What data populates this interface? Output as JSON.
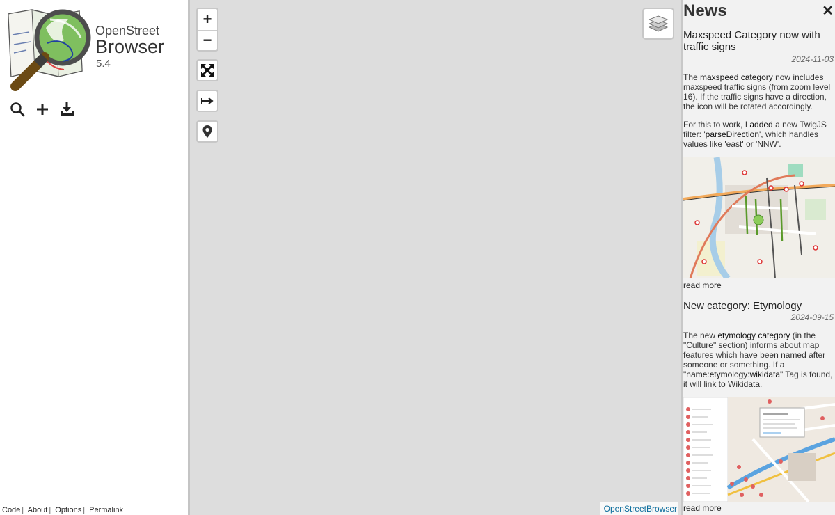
{
  "app": {
    "name_line1": "OpenStreet",
    "name_line2": "Browser",
    "version": "5.4"
  },
  "toolbar": {
    "icons": [
      "search-icon",
      "plus-icon",
      "download-icon"
    ]
  },
  "footer": {
    "links": [
      "Code",
      "About",
      "Options",
      "Permalink"
    ],
    "separator": "|"
  },
  "map": {
    "zoom_in": "+",
    "zoom_out": "−",
    "attribution": "OpenStreetBrowser",
    "background": "#dddddd"
  },
  "news": {
    "title": "News",
    "close": "✕",
    "articles": [
      {
        "title": "Maxspeed Category now with traffic signs",
        "date": "2024-11-03",
        "p1_a": "The ",
        "p1_b": "maxspeed category",
        "p1_c": " now includes maxspeed traffic signs (from zoom level 16). If the traffic signs have a direction, the icon will be rotated accordingly.",
        "p2_a": "For this to work, I ",
        "p2_b": "added",
        "p2_c": " a new TwigJS filter: '",
        "p2_d": "parseDirection",
        "p2_e": "', which handles values like 'east' or 'NNW'.",
        "read_more": "read more"
      },
      {
        "title": "New category: Etymology",
        "date": "2024-09-15",
        "p1_a": "The new ",
        "p1_b": "etymology category",
        "p1_c": " (in the \"Culture\" section) informs about map features which have been named after someone or something. If a \"",
        "p1_d": "name:etymology:wikidata",
        "p1_e": "\" Tag is found, it will link to Wikidata.",
        "read_more": "read more"
      }
    ]
  },
  "colors": {
    "link": "#0a6c9c",
    "panel_bg": "#f2f2f2"
  }
}
